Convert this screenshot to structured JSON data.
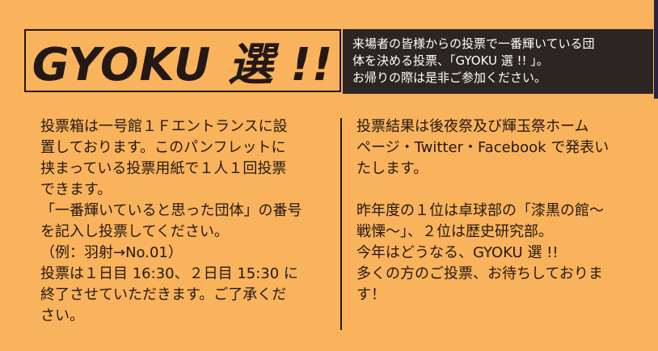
{
  "header": {
    "title": "GYOKU 選 !!",
    "intro_lines": [
      "来場者の皆様からの投票で一番輝いている団",
      "体を決める投票、「GYOKU 選 !! 」。",
      "お帰りの際は是非ご参加ください。"
    ]
  },
  "left_column": {
    "lines": [
      "投票箱は一号館１Ｆエントランスに設",
      "置しております。このパンフレットに",
      "挟まっている投票用紙で１人１回投票",
      "できます。",
      "「一番輝いていると思った団体」の番号",
      "を記入し投票してください。",
      "（例：羽射→No.01）",
      "投票は１日目 16:30、２日目 15:30 に",
      "終了させていただきます。ご了承くだ",
      "さい。"
    ]
  },
  "right_column": {
    "paragraph1": [
      "投票結果は後夜祭及び輝玉祭ホーム",
      "ページ・Twitter・Facebook で発表い",
      "たします。"
    ],
    "paragraph2": [
      "昨年度の１位は卓球部の「漆黒の館〜",
      "戦慄〜」、２位は歴史研究部。",
      "今年はどうなる、GYOKU 選 !!",
      "多くの方のご投票、お待ちしておりま",
      "す！"
    ]
  },
  "colors": {
    "background": "#f9b35c",
    "text": "#231815",
    "intro_box": "#2b2624",
    "intro_text": "#ffffff",
    "edge_bar": "#2a2240"
  }
}
